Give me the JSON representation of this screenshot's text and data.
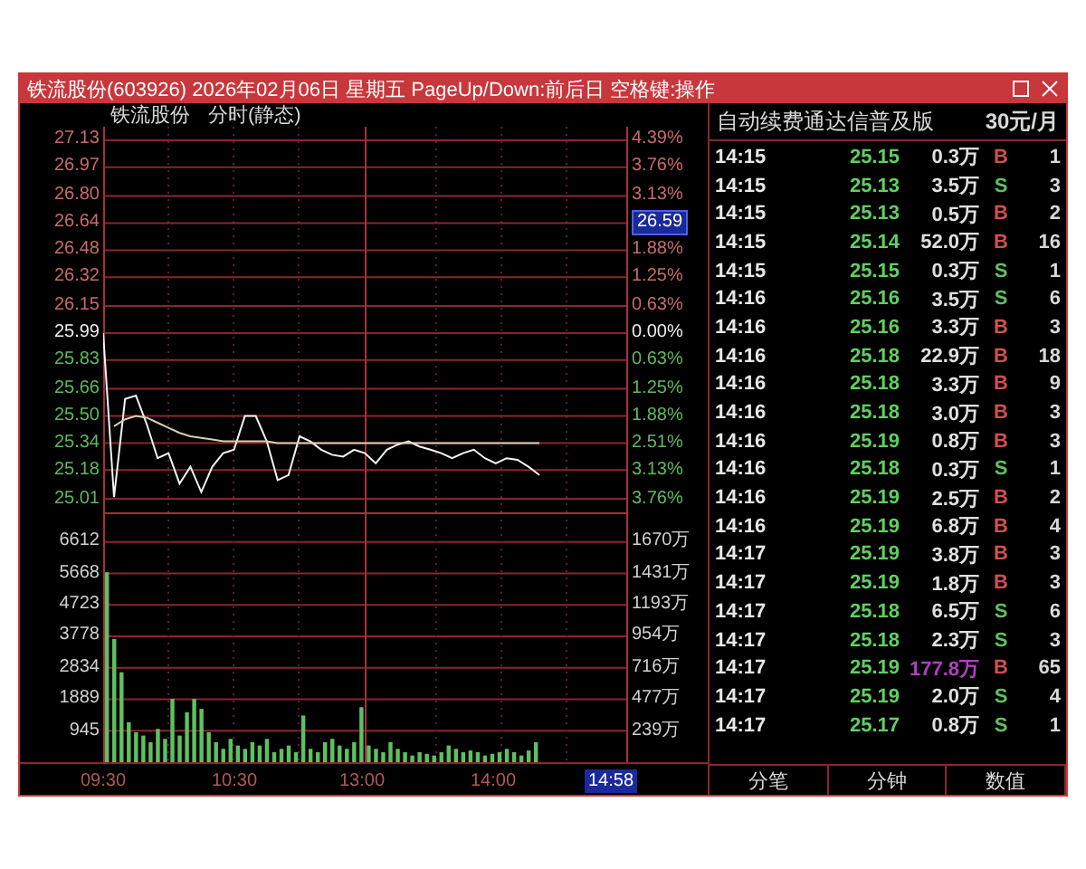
{
  "window": {
    "title": "铁流股份(603926) 2026年02月06日 星期五 PageUp/Down:前后日 空格键:操作"
  },
  "chart": {
    "stock_name": "铁流股份",
    "mode": "分时(静态)",
    "price_panel": {
      "right_labels": [
        {
          "text": "4.39%",
          "color": "#c86a6a"
        },
        {
          "text": "3.76%",
          "color": "#c86a6a"
        },
        {
          "text": "3.13%",
          "color": "#c86a6a"
        },
        {
          "tag": "26.59",
          "color": "#c86a6a"
        },
        {
          "text": "1.88%",
          "color": "#c86a6a"
        },
        {
          "text": "1.25%",
          "color": "#c86a6a"
        },
        {
          "text": "0.63%",
          "color": "#c86a6a"
        },
        {
          "text": "0.00%",
          "color": "#eeeeee"
        },
        {
          "text": "0.63%",
          "color": "#5fb85f"
        },
        {
          "text": "1.25%",
          "color": "#5fb85f"
        },
        {
          "text": "1.88%",
          "color": "#5fb85f"
        },
        {
          "text": "2.51%",
          "color": "#5fb85f"
        },
        {
          "text": "3.13%",
          "color": "#5fb85f"
        },
        {
          "text": "3.76%",
          "color": "#5fb85f"
        }
      ],
      "chart_data": {
        "type": "line",
        "grid": true,
        "ylim": [
          24.93,
          27.21
        ],
        "categories": [
          null,
          null,
          null,
          null,
          null,
          null,
          null,
          null,
          null,
          null,
          null,
          null,
          null,
          null,
          null,
          null,
          null,
          null,
          null,
          null,
          null,
          null,
          null,
          null,
          null,
          null,
          null,
          null,
          null,
          null,
          null,
          null,
          null,
          null,
          null,
          null,
          null,
          null,
          null,
          null,
          null
        ],
        "yticks": [
          {
            "value": 27.13,
            "label": "27.13"
          },
          {
            "value": 26.97,
            "label": "26.97"
          },
          {
            "value": 26.8,
            "label": "26.80"
          },
          {
            "value": 26.64,
            "label": "26.64"
          },
          {
            "value": 26.48,
            "label": "26.48"
          },
          {
            "value": 26.32,
            "label": "26.32"
          },
          {
            "value": 26.15,
            "label": "26.15"
          },
          {
            "value": 25.99,
            "label": "25.99"
          },
          {
            "value": 25.83,
            "label": "25.83"
          },
          {
            "value": 25.66,
            "label": "25.66"
          },
          {
            "value": 25.5,
            "label": "25.50"
          },
          {
            "value": 25.34,
            "label": "25.34"
          },
          {
            "value": 25.18,
            "label": "25.18"
          },
          {
            "value": 25.01,
            "label": "25.01"
          }
        ],
        "series": [
          {
            "color": "#f4f4f4",
            "values": [
              25.99,
              25.02,
              25.6,
              25.62,
              25.45,
              25.25,
              25.28,
              25.1,
              25.2,
              25.05,
              25.2,
              25.28,
              25.3,
              25.5,
              25.5,
              25.35,
              25.12,
              25.15,
              25.38,
              25.35,
              25.3,
              25.27,
              25.26,
              25.3,
              25.28,
              25.22,
              25.3,
              25.33,
              25.35,
              25.32,
              25.3,
              25.28,
              25.25,
              25.28,
              25.3,
              25.25,
              25.22,
              25.25,
              25.24,
              25.2,
              25.15
            ]
          },
          {
            "color": "#d8d0b0",
            "values": [
              null,
              25.44,
              25.48,
              25.5,
              25.49,
              25.46,
              25.43,
              25.4,
              25.38,
              25.37,
              25.36,
              25.35,
              25.35,
              25.35,
              25.35,
              25.35,
              25.34,
              25.34,
              25.34,
              25.34,
              25.34,
              25.34,
              25.34,
              25.34,
              25.34,
              25.34,
              25.34,
              25.34,
              25.34,
              25.34,
              25.34,
              25.34,
              25.34,
              25.34,
              25.34,
              25.34,
              25.34,
              25.34,
              25.34,
              25.34,
              25.34
            ]
          }
        ]
      }
    },
    "volume_panel": {
      "right_labels": [
        "1670万",
        "1431万",
        "1193万",
        "954万",
        "716万",
        "477万",
        "239万"
      ],
      "chart_data": {
        "type": "bar",
        "grid": true,
        "ylim": [
          0,
          7500
        ],
        "yticks": [
          {
            "value": 6612,
            "label": "6612"
          },
          {
            "value": 5668,
            "label": "5668"
          },
          {
            "value": 4723,
            "label": "4723"
          },
          {
            "value": 3778,
            "label": "3778"
          },
          {
            "value": 2834,
            "label": "2834"
          },
          {
            "value": 1889,
            "label": "1889"
          },
          {
            "value": 945,
            "label": "945"
          }
        ],
        "categories": [
          null,
          null,
          null,
          null,
          null,
          null,
          null,
          null,
          null,
          null,
          null,
          null,
          null,
          null,
          null,
          null,
          null,
          null,
          null,
          null,
          null,
          null,
          null,
          null,
          null,
          null,
          null,
          null,
          null,
          null,
          null,
          null,
          null,
          null,
          null,
          null,
          null,
          null,
          null,
          null,
          null,
          null,
          null,
          null,
          null,
          null,
          null,
          null,
          null,
          null,
          null,
          null,
          null,
          null,
          null,
          null,
          null,
          null,
          null,
          null
        ],
        "series": [
          {
            "color": "#5fc05f",
            "values": [
              5700,
              3700,
              2700,
              1200,
              900,
              800,
              600,
              1000,
              700,
              1900,
              800,
              1500,
              1900,
              1600,
              900,
              600,
              400,
              700,
              500,
              400,
              600,
              500,
              700,
              300,
              400,
              500,
              300,
              1400,
              400,
              300,
              600,
              700,
              500,
              400,
              600,
              1650,
              500,
              400,
              300,
              600,
              400,
              300,
              200,
              300,
              250,
              200,
              300,
              500,
              400,
              300,
              350,
              300,
              200,
              250,
              300,
              400,
              300,
              200,
              350,
              600
            ]
          }
        ]
      }
    },
    "time_axis": [
      "09:30",
      "10:30",
      "13:00",
      "14:00"
    ],
    "current_time": "14:58"
  },
  "trades_panel": {
    "title": "自动续费通达信普及版",
    "price_note": "30元/月",
    "trades": [
      {
        "time": "14:15",
        "price": "25.15",
        "volume": "0.3万",
        "side": "B",
        "count": "1",
        "large": false
      },
      {
        "time": "14:15",
        "price": "25.13",
        "volume": "3.5万",
        "side": "S",
        "count": "3",
        "large": false
      },
      {
        "time": "14:15",
        "price": "25.13",
        "volume": "0.5万",
        "side": "B",
        "count": "2",
        "large": false
      },
      {
        "time": "14:15",
        "price": "25.14",
        "volume": "52.0万",
        "side": "B",
        "count": "16",
        "large": false
      },
      {
        "time": "14:15",
        "price": "25.15",
        "volume": "0.3万",
        "side": "S",
        "count": "1",
        "large": false
      },
      {
        "time": "14:16",
        "price": "25.16",
        "volume": "3.5万",
        "side": "S",
        "count": "6",
        "large": false
      },
      {
        "time": "14:16",
        "price": "25.16",
        "volume": "3.3万",
        "side": "B",
        "count": "3",
        "large": false
      },
      {
        "time": "14:16",
        "price": "25.18",
        "volume": "22.9万",
        "side": "B",
        "count": "18",
        "large": false
      },
      {
        "time": "14:16",
        "price": "25.18",
        "volume": "3.3万",
        "side": "B",
        "count": "9",
        "large": false
      },
      {
        "time": "14:16",
        "price": "25.18",
        "volume": "3.0万",
        "side": "B",
        "count": "3",
        "large": false
      },
      {
        "time": "14:16",
        "price": "25.19",
        "volume": "0.8万",
        "side": "B",
        "count": "3",
        "large": false
      },
      {
        "time": "14:16",
        "price": "25.18",
        "volume": "0.3万",
        "side": "S",
        "count": "1",
        "large": false
      },
      {
        "time": "14:16",
        "price": "25.19",
        "volume": "2.5万",
        "side": "B",
        "count": "2",
        "large": false
      },
      {
        "time": "14:16",
        "price": "25.19",
        "volume": "6.8万",
        "side": "B",
        "count": "4",
        "large": false
      },
      {
        "time": "14:17",
        "price": "25.19",
        "volume": "3.8万",
        "side": "B",
        "count": "3",
        "large": false
      },
      {
        "time": "14:17",
        "price": "25.19",
        "volume": "1.8万",
        "side": "B",
        "count": "3",
        "large": false
      },
      {
        "time": "14:17",
        "price": "25.18",
        "volume": "6.5万",
        "side": "S",
        "count": "6",
        "large": false
      },
      {
        "time": "14:17",
        "price": "25.18",
        "volume": "2.3万",
        "side": "S",
        "count": "3",
        "large": false
      },
      {
        "time": "14:17",
        "price": "25.19",
        "volume": "177.8万",
        "side": "B",
        "count": "65",
        "large": true
      },
      {
        "time": "14:17",
        "price": "25.19",
        "volume": "2.0万",
        "side": "S",
        "count": "4",
        "large": false
      },
      {
        "time": "14:17",
        "price": "25.17",
        "volume": "0.8万",
        "side": "S",
        "count": "1",
        "large": false
      }
    ],
    "tabs": [
      "分笔",
      "分钟",
      "数值"
    ]
  }
}
